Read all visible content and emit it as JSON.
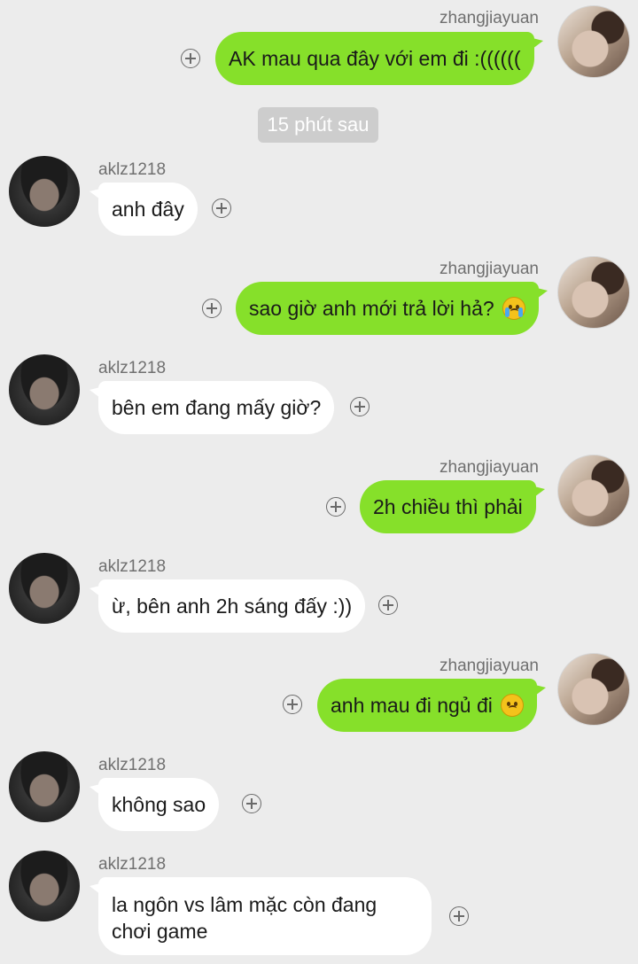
{
  "users": {
    "me": "zhangjiayuan",
    "other": "aklz1218"
  },
  "timestamp": "15 phút sau",
  "messages": [
    {
      "sender": "zhangjiayuan",
      "text": "AK mau qua đây với em đi :((((((",
      "emoji": null
    },
    {
      "sender": "aklz1218",
      "text": "anh đây",
      "emoji": null
    },
    {
      "sender": "zhangjiayuan",
      "text": "sao giờ anh mới trả lời hả?",
      "emoji": "loudly-crying-face-emoji"
    },
    {
      "sender": "aklz1218",
      "text": "bên em đang mấy giờ?",
      "emoji": null
    },
    {
      "sender": "zhangjiayuan",
      "text": "2h chiều thì phải",
      "emoji": null
    },
    {
      "sender": "aklz1218",
      "text": "ừ, bên anh 2h sáng đấy :))",
      "emoji": null
    },
    {
      "sender": "zhangjiayuan",
      "text": "anh mau đi ngủ đi",
      "emoji": "pleading-face-emoji"
    },
    {
      "sender": "aklz1218",
      "text": "không sao",
      "emoji": null
    },
    {
      "sender": "aklz1218",
      "text": "la ngôn vs lâm mặc còn đang chơi game",
      "emoji": null
    }
  ],
  "colors": {
    "background": "#ececec",
    "sent_bubble": "#86e02a",
    "received_bubble": "#ffffff",
    "timestamp_pill": "#cdcdcd"
  }
}
